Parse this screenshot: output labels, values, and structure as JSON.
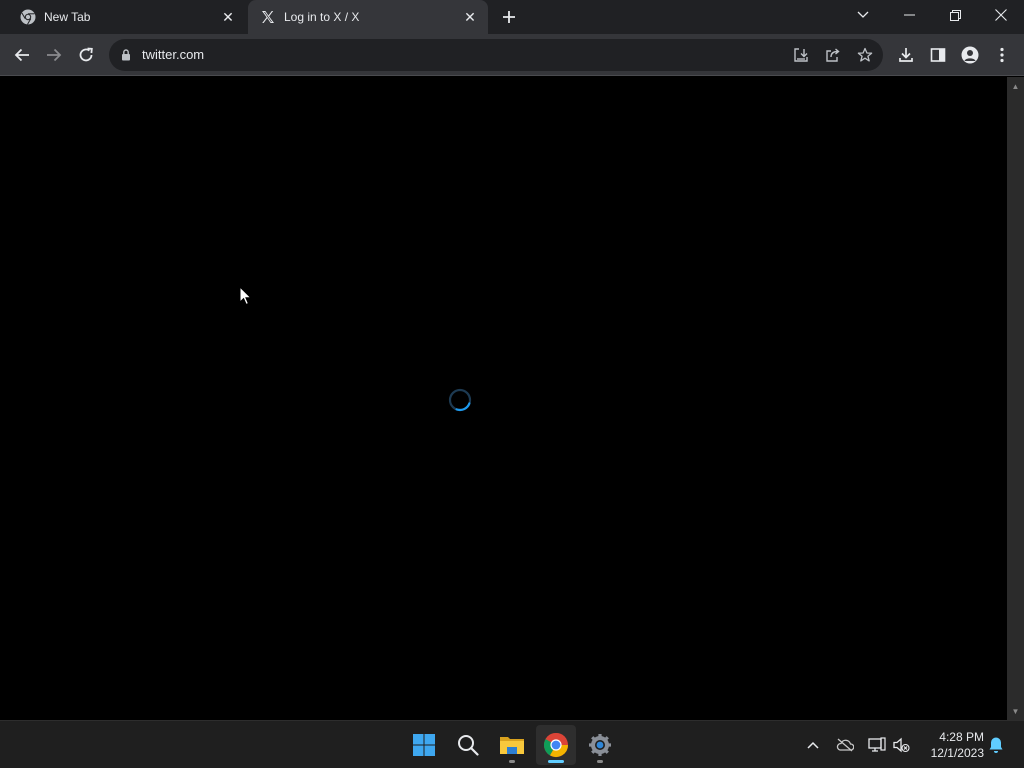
{
  "tabs": [
    {
      "title": "New Tab",
      "favicon": "chrome-icon",
      "active": false
    },
    {
      "title": "Log in to X / X",
      "favicon": "x-logo-icon",
      "active": true
    }
  ],
  "window_controls": [
    "tab-search-icon",
    "minimize-icon",
    "restore-icon",
    "close-icon"
  ],
  "toolbar": {
    "url": "twitter.com",
    "nav_icons": [
      "back-icon",
      "forward-icon",
      "reload-icon"
    ],
    "omnibox_icons": [
      "install-app-icon",
      "share-icon",
      "bookmark-star-icon"
    ],
    "right_icons": [
      "downloads-icon",
      "side-panel-icon",
      "profile-icon",
      "menu-icon"
    ]
  },
  "page": {
    "state": "loading",
    "spinner_color": "#1d9bf0"
  },
  "taskbar": {
    "apps": [
      {
        "name": "start",
        "icon": "windows-start-icon",
        "running": false
      },
      {
        "name": "search",
        "icon": "search-icon",
        "running": false
      },
      {
        "name": "file-explorer",
        "icon": "folder-icon",
        "running": true
      },
      {
        "name": "chrome",
        "icon": "chrome-icon",
        "running": true,
        "active": true
      },
      {
        "name": "settings",
        "icon": "gear-icon",
        "running": true
      }
    ],
    "tray_icons": [
      "chevron-up-icon",
      "onedrive-icon",
      "network-icon",
      "volume-muted-icon",
      "notification-bell-icon"
    ],
    "time": "4:28 PM",
    "date": "12/1/2023"
  },
  "colors": {
    "titlebar": "#202124",
    "toolbar": "#35363a",
    "omnibox": "#202124",
    "page_background": "#000000",
    "taskbar": "#1f1f1f",
    "accent": "#60cdff"
  }
}
